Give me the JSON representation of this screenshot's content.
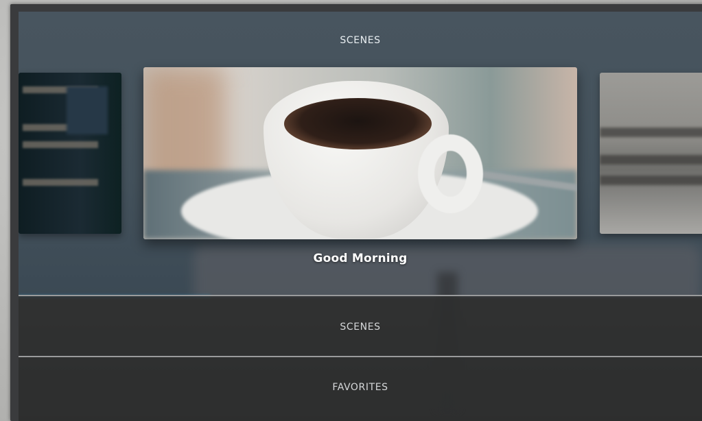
{
  "header": {
    "title": "SCENES"
  },
  "carousel": {
    "items": [
      {
        "id": "left"
      },
      {
        "title": "Good Morning"
      },
      {
        "id": "right"
      }
    ]
  },
  "tabs": [
    {
      "label": "SCENES"
    },
    {
      "label": "FAVORITES"
    }
  ]
}
